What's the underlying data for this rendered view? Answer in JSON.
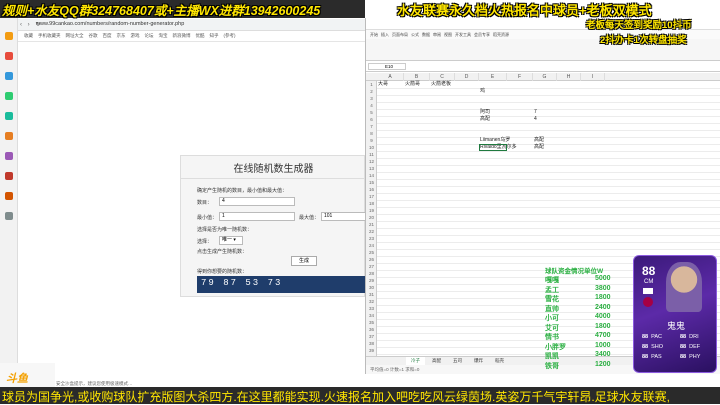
{
  "overlays": {
    "top_left": "规则+水友QQ群324768407或+主播WX进群13942600245",
    "top_right": "水友联赛永久档火热报名中球员+老板双模式",
    "badge1": "老板每天签到奖励10抖币",
    "badge2": "2抖办卡1次转盘抽奖",
    "ticker": "球员为国争光,或收购球队扩充版图大杀四方.在这里都能实现.火速报名加入吧吃吃风云绿茵场.英姿万千气宇轩昂.足球水友联赛,"
  },
  "browser": {
    "url": "www.99cankao.com/numbers/random-number-generator.php",
    "nav": "‹ › ↻",
    "bookmarks": [
      "收藏",
      "手机收藏夹",
      "网址大全",
      "谷歌",
      "百度",
      "京东",
      "游戏",
      "论坛",
      "淘宝",
      "新浪微博",
      "优酷",
      "知乎",
      "(参考)"
    ],
    "footer_logo": "斗鱼",
    "footer_status": "安全沙盒提示，建议您使用极速模式…"
  },
  "rng": {
    "title": "在线随机数生成器",
    "desc": "确定产生随机的数目，最小值和最大值：",
    "count_label": "数目：",
    "count_value": "4",
    "min_label": "最小值：",
    "min_value": "1",
    "max_label": "最大值：",
    "max_value": "101",
    "unique_label": "选择是否为唯一随机数：",
    "select_label": "选择：",
    "select_value": "唯一",
    "generate_hint": "点击生成产生随机数：",
    "generate_button": "生成",
    "result_label": "得到你想要的随机数：",
    "result": "79  87  53  73"
  },
  "sheet": {
    "namebox": "E10",
    "ribbon_tabs": [
      "开始",
      "插入",
      "页面布局",
      "公式",
      "数据",
      "审阅",
      "视图",
      "开发工具",
      "会员专享",
      "稻壳资源"
    ],
    "columns": [
      "A",
      "B",
      "C",
      "D",
      "E",
      "F",
      "G",
      "H",
      "I"
    ],
    "rows": [
      "1",
      "2",
      "3",
      "4",
      "5",
      "6",
      "7",
      "8",
      "9",
      "10",
      "11",
      "12",
      "13",
      "14",
      "15",
      "16",
      "17",
      "18",
      "19",
      "20",
      "21",
      "22",
      "23",
      "24",
      "25",
      "26",
      "27",
      "28",
      "29",
      "30",
      "31",
      "32",
      "33",
      "34",
      "35",
      "36",
      "37",
      "38",
      "39"
    ],
    "cells": {
      "A1": "大哥",
      "B1": "火箭哥",
      "C1": "火箭老板",
      "E2": "鸡",
      "E5": "阿司",
      "G5": "7",
      "E6": "高配",
      "G6": "4",
      "E9": "Liimanen乌罗",
      "G9": "高配",
      "E10": "Rivaldo里瓦尔多",
      "G10": "高配"
    },
    "sheet_tabs": [
      "冷子",
      "高配",
      "五司",
      "爆炸",
      "稻壳"
    ],
    "status": "平均值=0  计数=1  求和=0"
  },
  "funding": {
    "title": "球队资金情况单位W",
    "rows": [
      {
        "name": "嘎嘎",
        "amount": "5000"
      },
      {
        "name": "孟工",
        "amount": "3800"
      },
      {
        "name": "雪花",
        "amount": "1800"
      },
      {
        "name": "直帅",
        "amount": "2400"
      },
      {
        "name": "小可",
        "amount": "4000"
      },
      {
        "name": "艾可",
        "amount": "1800"
      },
      {
        "name": "情书",
        "amount": "4700"
      },
      {
        "name": "小胖罗",
        "amount": "1000"
      },
      {
        "name": "凯凯",
        "amount": "3400"
      },
      {
        "name": "铁哥",
        "amount": "1200"
      }
    ]
  },
  "card": {
    "rating": "88",
    "position": "CM",
    "name": "鬼鬼",
    "stats": [
      {
        "value": "88",
        "label": "PAC"
      },
      {
        "value": "88",
        "label": "SHO"
      },
      {
        "value": "88",
        "label": "PAS"
      },
      {
        "value": "88",
        "label": "DRI"
      },
      {
        "value": "88",
        "label": "DEF"
      },
      {
        "value": "88",
        "label": "PHY"
      }
    ]
  },
  "colors": {
    "overlay_yellow": "#ffe600",
    "funding_green": "#2cb043",
    "card_purple": "#5c2aa8",
    "result_bg": "#1f3d6b"
  }
}
